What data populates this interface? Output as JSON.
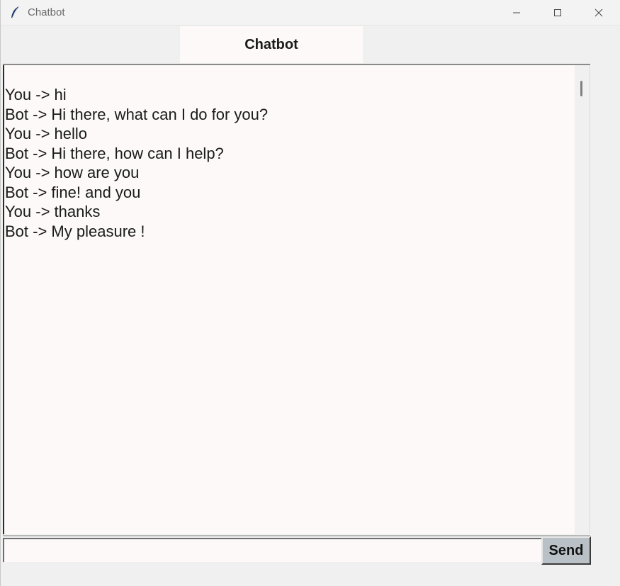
{
  "window": {
    "title": "Chatbot",
    "icon": "feather-icon"
  },
  "header": {
    "title": "Chatbot"
  },
  "chat": {
    "lines": [
      "You -> hi",
      "Bot -> Hi there, what can I do for you?",
      "You -> hello",
      "Bot -> Hi there, how can I help?",
      "You -> how are you",
      "Bot -> fine! and you",
      "You -> thanks",
      "Bot -> My pleasure !"
    ]
  },
  "input": {
    "value": "",
    "placeholder": ""
  },
  "send_button": {
    "label": "Send"
  },
  "colors": {
    "text_bg": "#fcf9f8",
    "window_bg": "#f0f0f0",
    "button_bg": "#b9c0c6"
  }
}
